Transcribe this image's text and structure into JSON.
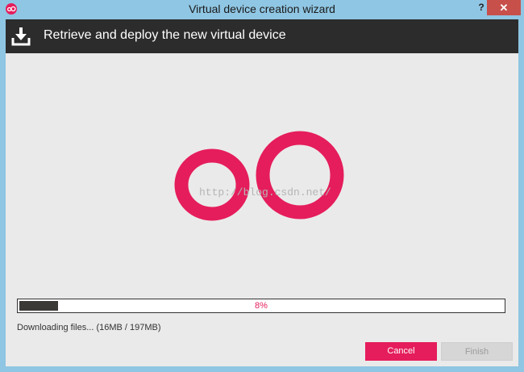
{
  "window": {
    "title": "Virtual device creation wizard",
    "help_label": "?",
    "close_label": "✕"
  },
  "header": {
    "title": "Retrieve and deploy the new virtual device",
    "icon": "download-tray-icon"
  },
  "logo": {
    "icon": "oo-logo"
  },
  "watermark": {
    "text": "http://blog.csdn.net/"
  },
  "progress": {
    "percent": 8,
    "label": "8%"
  },
  "status": {
    "text": "Downloading files... (16MB / 197MB)"
  },
  "buttons": {
    "cancel_label": "Cancel",
    "finish_label": "Finish"
  },
  "colors": {
    "accent": "#e51d5c",
    "header_bg": "#2c2c2c",
    "body_bg": "#ebeaea",
    "window_frame": "#8fc6e3",
    "close_bg": "#c7504b"
  }
}
